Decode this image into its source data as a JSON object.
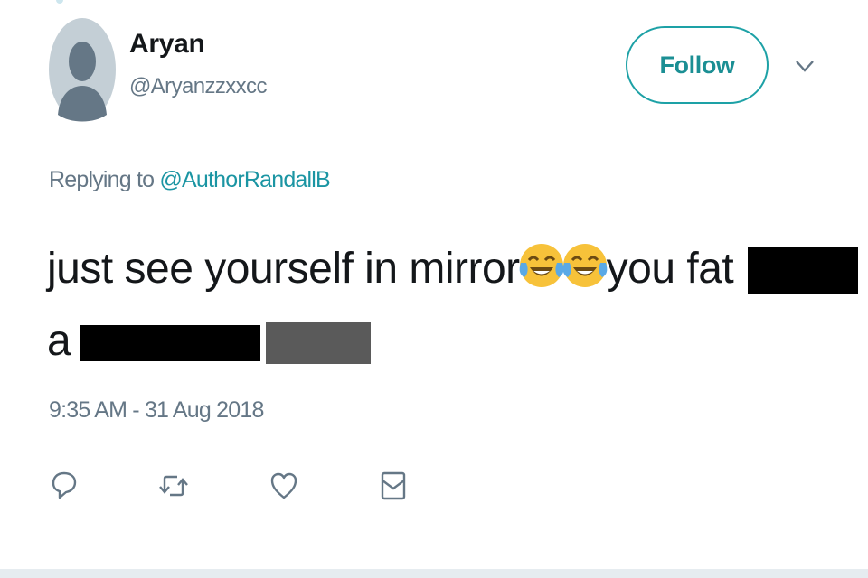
{
  "tweet": {
    "author_name": "Aryan",
    "author_handle": "@Aryanzzxxcc",
    "follow_label": "Follow",
    "reply_prefix": "Replying to ",
    "reply_mention": "@AuthorRandallB",
    "text_line1_start": "just see yourself in mirror",
    "text_line1_end": "you fat",
    "text_line2_prefix": "a",
    "emoji": [
      "face-with-tears-of-joy",
      "face-with-tears-of-joy"
    ],
    "redacted_in_original": 2,
    "masked_word_note": "[slur masked]",
    "timestamp": "9:35 AM - 31 Aug 2018"
  },
  "actions": [
    "reply-icon",
    "retweet-icon",
    "like-icon",
    "direct-message-icon"
  ],
  "colors": {
    "accent": "#1da1a6",
    "secondary_text": "#657786",
    "primary_text": "#14171a",
    "redaction": "#000000",
    "emoji_yellow": "#f7c23a",
    "emoji_tears": "#5aa9e6"
  }
}
